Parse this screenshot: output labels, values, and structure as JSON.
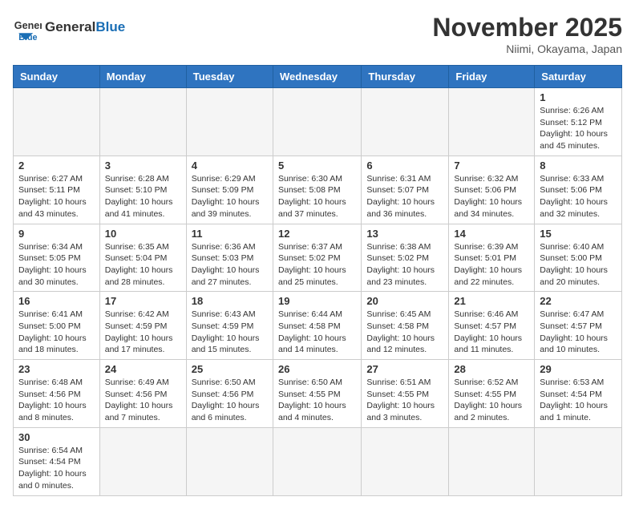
{
  "header": {
    "logo_general": "General",
    "logo_blue": "Blue",
    "month_title": "November 2025",
    "location": "Niimi, Okayama, Japan"
  },
  "weekdays": [
    "Sunday",
    "Monday",
    "Tuesday",
    "Wednesday",
    "Thursday",
    "Friday",
    "Saturday"
  ],
  "days": {
    "d1": {
      "num": "1",
      "sunrise": "6:26 AM",
      "sunset": "5:12 PM",
      "daylight": "10 hours and 45 minutes."
    },
    "d2": {
      "num": "2",
      "sunrise": "6:27 AM",
      "sunset": "5:11 PM",
      "daylight": "10 hours and 43 minutes."
    },
    "d3": {
      "num": "3",
      "sunrise": "6:28 AM",
      "sunset": "5:10 PM",
      "daylight": "10 hours and 41 minutes."
    },
    "d4": {
      "num": "4",
      "sunrise": "6:29 AM",
      "sunset": "5:09 PM",
      "daylight": "10 hours and 39 minutes."
    },
    "d5": {
      "num": "5",
      "sunrise": "6:30 AM",
      "sunset": "5:08 PM",
      "daylight": "10 hours and 37 minutes."
    },
    "d6": {
      "num": "6",
      "sunrise": "6:31 AM",
      "sunset": "5:07 PM",
      "daylight": "10 hours and 36 minutes."
    },
    "d7": {
      "num": "7",
      "sunrise": "6:32 AM",
      "sunset": "5:06 PM",
      "daylight": "10 hours and 34 minutes."
    },
    "d8": {
      "num": "8",
      "sunrise": "6:33 AM",
      "sunset": "5:06 PM",
      "daylight": "10 hours and 32 minutes."
    },
    "d9": {
      "num": "9",
      "sunrise": "6:34 AM",
      "sunset": "5:05 PM",
      "daylight": "10 hours and 30 minutes."
    },
    "d10": {
      "num": "10",
      "sunrise": "6:35 AM",
      "sunset": "5:04 PM",
      "daylight": "10 hours and 28 minutes."
    },
    "d11": {
      "num": "11",
      "sunrise": "6:36 AM",
      "sunset": "5:03 PM",
      "daylight": "10 hours and 27 minutes."
    },
    "d12": {
      "num": "12",
      "sunrise": "6:37 AM",
      "sunset": "5:02 PM",
      "daylight": "10 hours and 25 minutes."
    },
    "d13": {
      "num": "13",
      "sunrise": "6:38 AM",
      "sunset": "5:02 PM",
      "daylight": "10 hours and 23 minutes."
    },
    "d14": {
      "num": "14",
      "sunrise": "6:39 AM",
      "sunset": "5:01 PM",
      "daylight": "10 hours and 22 minutes."
    },
    "d15": {
      "num": "15",
      "sunrise": "6:40 AM",
      "sunset": "5:00 PM",
      "daylight": "10 hours and 20 minutes."
    },
    "d16": {
      "num": "16",
      "sunrise": "6:41 AM",
      "sunset": "5:00 PM",
      "daylight": "10 hours and 18 minutes."
    },
    "d17": {
      "num": "17",
      "sunrise": "6:42 AM",
      "sunset": "4:59 PM",
      "daylight": "10 hours and 17 minutes."
    },
    "d18": {
      "num": "18",
      "sunrise": "6:43 AM",
      "sunset": "4:59 PM",
      "daylight": "10 hours and 15 minutes."
    },
    "d19": {
      "num": "19",
      "sunrise": "6:44 AM",
      "sunset": "4:58 PM",
      "daylight": "10 hours and 14 minutes."
    },
    "d20": {
      "num": "20",
      "sunrise": "6:45 AM",
      "sunset": "4:58 PM",
      "daylight": "10 hours and 12 minutes."
    },
    "d21": {
      "num": "21",
      "sunrise": "6:46 AM",
      "sunset": "4:57 PM",
      "daylight": "10 hours and 11 minutes."
    },
    "d22": {
      "num": "22",
      "sunrise": "6:47 AM",
      "sunset": "4:57 PM",
      "daylight": "10 hours and 10 minutes."
    },
    "d23": {
      "num": "23",
      "sunrise": "6:48 AM",
      "sunset": "4:56 PM",
      "daylight": "10 hours and 8 minutes."
    },
    "d24": {
      "num": "24",
      "sunrise": "6:49 AM",
      "sunset": "4:56 PM",
      "daylight": "10 hours and 7 minutes."
    },
    "d25": {
      "num": "25",
      "sunrise": "6:50 AM",
      "sunset": "4:56 PM",
      "daylight": "10 hours and 6 minutes."
    },
    "d26": {
      "num": "26",
      "sunrise": "6:50 AM",
      "sunset": "4:55 PM",
      "daylight": "10 hours and 4 minutes."
    },
    "d27": {
      "num": "27",
      "sunrise": "6:51 AM",
      "sunset": "4:55 PM",
      "daylight": "10 hours and 3 minutes."
    },
    "d28": {
      "num": "28",
      "sunrise": "6:52 AM",
      "sunset": "4:55 PM",
      "daylight": "10 hours and 2 minutes."
    },
    "d29": {
      "num": "29",
      "sunrise": "6:53 AM",
      "sunset": "4:54 PM",
      "daylight": "10 hours and 1 minute."
    },
    "d30": {
      "num": "30",
      "sunrise": "6:54 AM",
      "sunset": "4:54 PM",
      "daylight": "10 hours and 0 minutes."
    }
  }
}
